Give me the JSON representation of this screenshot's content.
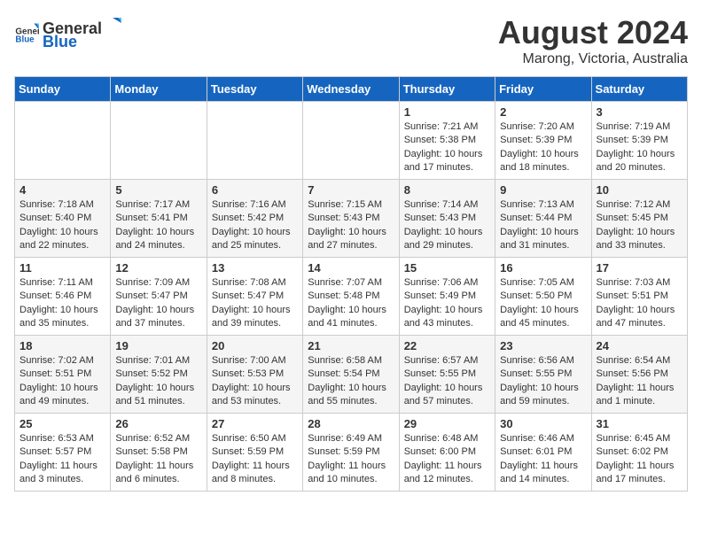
{
  "header": {
    "logo_general": "General",
    "logo_blue": "Blue",
    "title": "August 2024",
    "subtitle": "Marong, Victoria, Australia"
  },
  "days_of_week": [
    "Sunday",
    "Monday",
    "Tuesday",
    "Wednesday",
    "Thursday",
    "Friday",
    "Saturday"
  ],
  "weeks": [
    [
      {
        "day": "",
        "info": ""
      },
      {
        "day": "",
        "info": ""
      },
      {
        "day": "",
        "info": ""
      },
      {
        "day": "",
        "info": ""
      },
      {
        "day": "1",
        "info": "Sunrise: 7:21 AM\nSunset: 5:38 PM\nDaylight: 10 hours\nand 17 minutes."
      },
      {
        "day": "2",
        "info": "Sunrise: 7:20 AM\nSunset: 5:39 PM\nDaylight: 10 hours\nand 18 minutes."
      },
      {
        "day": "3",
        "info": "Sunrise: 7:19 AM\nSunset: 5:39 PM\nDaylight: 10 hours\nand 20 minutes."
      }
    ],
    [
      {
        "day": "4",
        "info": "Sunrise: 7:18 AM\nSunset: 5:40 PM\nDaylight: 10 hours\nand 22 minutes."
      },
      {
        "day": "5",
        "info": "Sunrise: 7:17 AM\nSunset: 5:41 PM\nDaylight: 10 hours\nand 24 minutes."
      },
      {
        "day": "6",
        "info": "Sunrise: 7:16 AM\nSunset: 5:42 PM\nDaylight: 10 hours\nand 25 minutes."
      },
      {
        "day": "7",
        "info": "Sunrise: 7:15 AM\nSunset: 5:43 PM\nDaylight: 10 hours\nand 27 minutes."
      },
      {
        "day": "8",
        "info": "Sunrise: 7:14 AM\nSunset: 5:43 PM\nDaylight: 10 hours\nand 29 minutes."
      },
      {
        "day": "9",
        "info": "Sunrise: 7:13 AM\nSunset: 5:44 PM\nDaylight: 10 hours\nand 31 minutes."
      },
      {
        "day": "10",
        "info": "Sunrise: 7:12 AM\nSunset: 5:45 PM\nDaylight: 10 hours\nand 33 minutes."
      }
    ],
    [
      {
        "day": "11",
        "info": "Sunrise: 7:11 AM\nSunset: 5:46 PM\nDaylight: 10 hours\nand 35 minutes."
      },
      {
        "day": "12",
        "info": "Sunrise: 7:09 AM\nSunset: 5:47 PM\nDaylight: 10 hours\nand 37 minutes."
      },
      {
        "day": "13",
        "info": "Sunrise: 7:08 AM\nSunset: 5:47 PM\nDaylight: 10 hours\nand 39 minutes."
      },
      {
        "day": "14",
        "info": "Sunrise: 7:07 AM\nSunset: 5:48 PM\nDaylight: 10 hours\nand 41 minutes."
      },
      {
        "day": "15",
        "info": "Sunrise: 7:06 AM\nSunset: 5:49 PM\nDaylight: 10 hours\nand 43 minutes."
      },
      {
        "day": "16",
        "info": "Sunrise: 7:05 AM\nSunset: 5:50 PM\nDaylight: 10 hours\nand 45 minutes."
      },
      {
        "day": "17",
        "info": "Sunrise: 7:03 AM\nSunset: 5:51 PM\nDaylight: 10 hours\nand 47 minutes."
      }
    ],
    [
      {
        "day": "18",
        "info": "Sunrise: 7:02 AM\nSunset: 5:51 PM\nDaylight: 10 hours\nand 49 minutes."
      },
      {
        "day": "19",
        "info": "Sunrise: 7:01 AM\nSunset: 5:52 PM\nDaylight: 10 hours\nand 51 minutes."
      },
      {
        "day": "20",
        "info": "Sunrise: 7:00 AM\nSunset: 5:53 PM\nDaylight: 10 hours\nand 53 minutes."
      },
      {
        "day": "21",
        "info": "Sunrise: 6:58 AM\nSunset: 5:54 PM\nDaylight: 10 hours\nand 55 minutes."
      },
      {
        "day": "22",
        "info": "Sunrise: 6:57 AM\nSunset: 5:55 PM\nDaylight: 10 hours\nand 57 minutes."
      },
      {
        "day": "23",
        "info": "Sunrise: 6:56 AM\nSunset: 5:55 PM\nDaylight: 10 hours\nand 59 minutes."
      },
      {
        "day": "24",
        "info": "Sunrise: 6:54 AM\nSunset: 5:56 PM\nDaylight: 11 hours\nand 1 minute."
      }
    ],
    [
      {
        "day": "25",
        "info": "Sunrise: 6:53 AM\nSunset: 5:57 PM\nDaylight: 11 hours\nand 3 minutes."
      },
      {
        "day": "26",
        "info": "Sunrise: 6:52 AM\nSunset: 5:58 PM\nDaylight: 11 hours\nand 6 minutes."
      },
      {
        "day": "27",
        "info": "Sunrise: 6:50 AM\nSunset: 5:59 PM\nDaylight: 11 hours\nand 8 minutes."
      },
      {
        "day": "28",
        "info": "Sunrise: 6:49 AM\nSunset: 5:59 PM\nDaylight: 11 hours\nand 10 minutes."
      },
      {
        "day": "29",
        "info": "Sunrise: 6:48 AM\nSunset: 6:00 PM\nDaylight: 11 hours\nand 12 minutes."
      },
      {
        "day": "30",
        "info": "Sunrise: 6:46 AM\nSunset: 6:01 PM\nDaylight: 11 hours\nand 14 minutes."
      },
      {
        "day": "31",
        "info": "Sunrise: 6:45 AM\nSunset: 6:02 PM\nDaylight: 11 hours\nand 17 minutes."
      }
    ]
  ]
}
